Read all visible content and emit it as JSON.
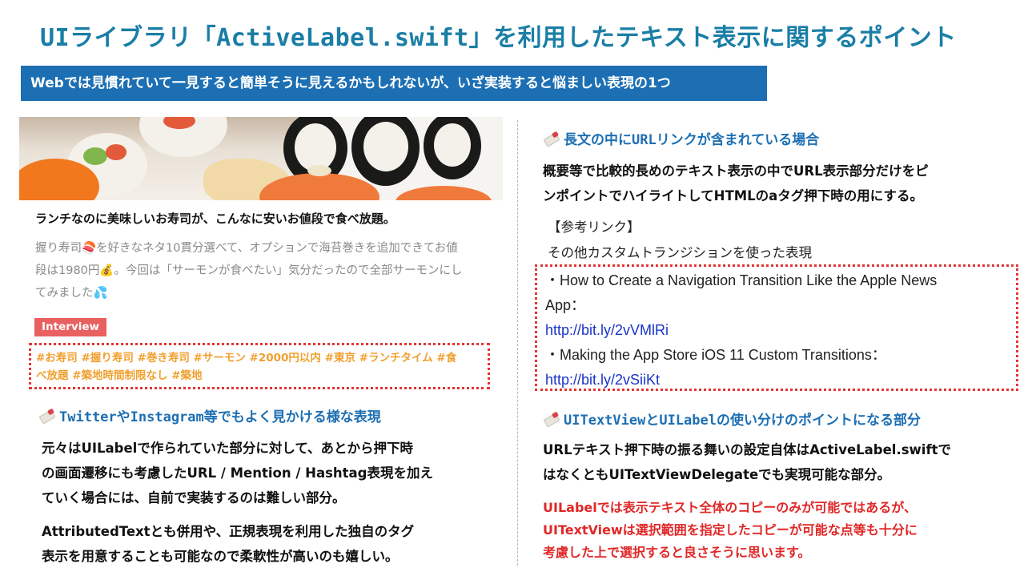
{
  "title": "UIライブラリ「ActiveLabel.swift」を利用したテキスト表示に関するポイント",
  "banner": "Webでは見慣れていて一見すると簡単そうに見えるかもしれないが、いざ実装すると悩ましい表現の1つ",
  "card": {
    "title": "ランチなのに美味しいお寿司が、こんなに安いお値段で食べ放題。",
    "body_line1": "握り寿司🍣を好きなネタ10貫分選べて、オプションで海苔巻きを追加できてお値",
    "body_line2": "段は1980円💰。今回は「サーモンが食べたい」気分だったので全部サーモンにし",
    "body_line3": "てみました💦",
    "badge": "Interview",
    "hashtags_line1": "#お寿司 #握り寿司 #巻き寿司 #サーモン #2000円以内 #東京 #ランチタイム #食",
    "hashtags_line2": "べ放題 #築地時間制限なし #築地"
  },
  "left_section": {
    "heading": "TwitterやInstagram等でもよく見かける様な表現",
    "para1_line1": "元々はUILabelで作られていた部分に対して、あとから押下時",
    "para1_line2": "の画面遷移にも考慮したURL / Mention / Hashtag表現を加え",
    "para1_line3": "ていく場合には、自前で実装するのは難しい部分。",
    "para2_line1": "AttributedTextとも併用や、正規表現を利用した独自のタグ",
    "para2_line2": "表示を用意することも可能なので柔軟性が高いのも嬉しい。"
  },
  "right_top": {
    "heading": "長文の中にURLリンクが含まれている場合",
    "para_line1": "概要等で比較的長めのテキスト表示の中でURL表示部分だけをピ",
    "para_line2": "ンポイントでハイライトしてHTMLのaタグ押下時の用にする。",
    "ref_label": "【参考リンク】",
    "ref_desc": "その他カスタムトランジションを使った表現",
    "link1_title_line1": "・How to Create a Navigation Transition Like the Apple News",
    "link1_title_line2": "App：",
    "link1_url": "http://bit.ly/2vVMlRi",
    "link2_title": "・Making the App Store iOS 11 Custom Transitions：",
    "link2_url": "http://bit.ly/2vSiiKt"
  },
  "right_bottom": {
    "heading": "UITextViewとUILabelの使い分けのポイントになる部分",
    "para_line1": "URLテキスト押下時の振る舞いの設定自体はActiveLabel.swiftで",
    "para_line2": "はなくともUITextViewDelegateでも実現可能な部分。",
    "red_line1": "UILabelでは表示テキスト全体のコピーのみが可能ではあるが、",
    "red_line2": "UITextViewは選択範囲を指定したコピーが可能な点等も十分に",
    "red_line3": "考慮した上で選択すると良さそうに思います。"
  },
  "colors": {
    "title": "#1a7ea6",
    "banner_bg": "#1d6fb3",
    "heading": "#1d6fb3",
    "hashtag": "#f0a030",
    "badge_bg": "#e86060",
    "highlight_border": "#e03636",
    "link": "#1a35c9",
    "warning_text": "#e02828"
  },
  "icons": {
    "section_heading_icon": "pushpin-icon"
  }
}
